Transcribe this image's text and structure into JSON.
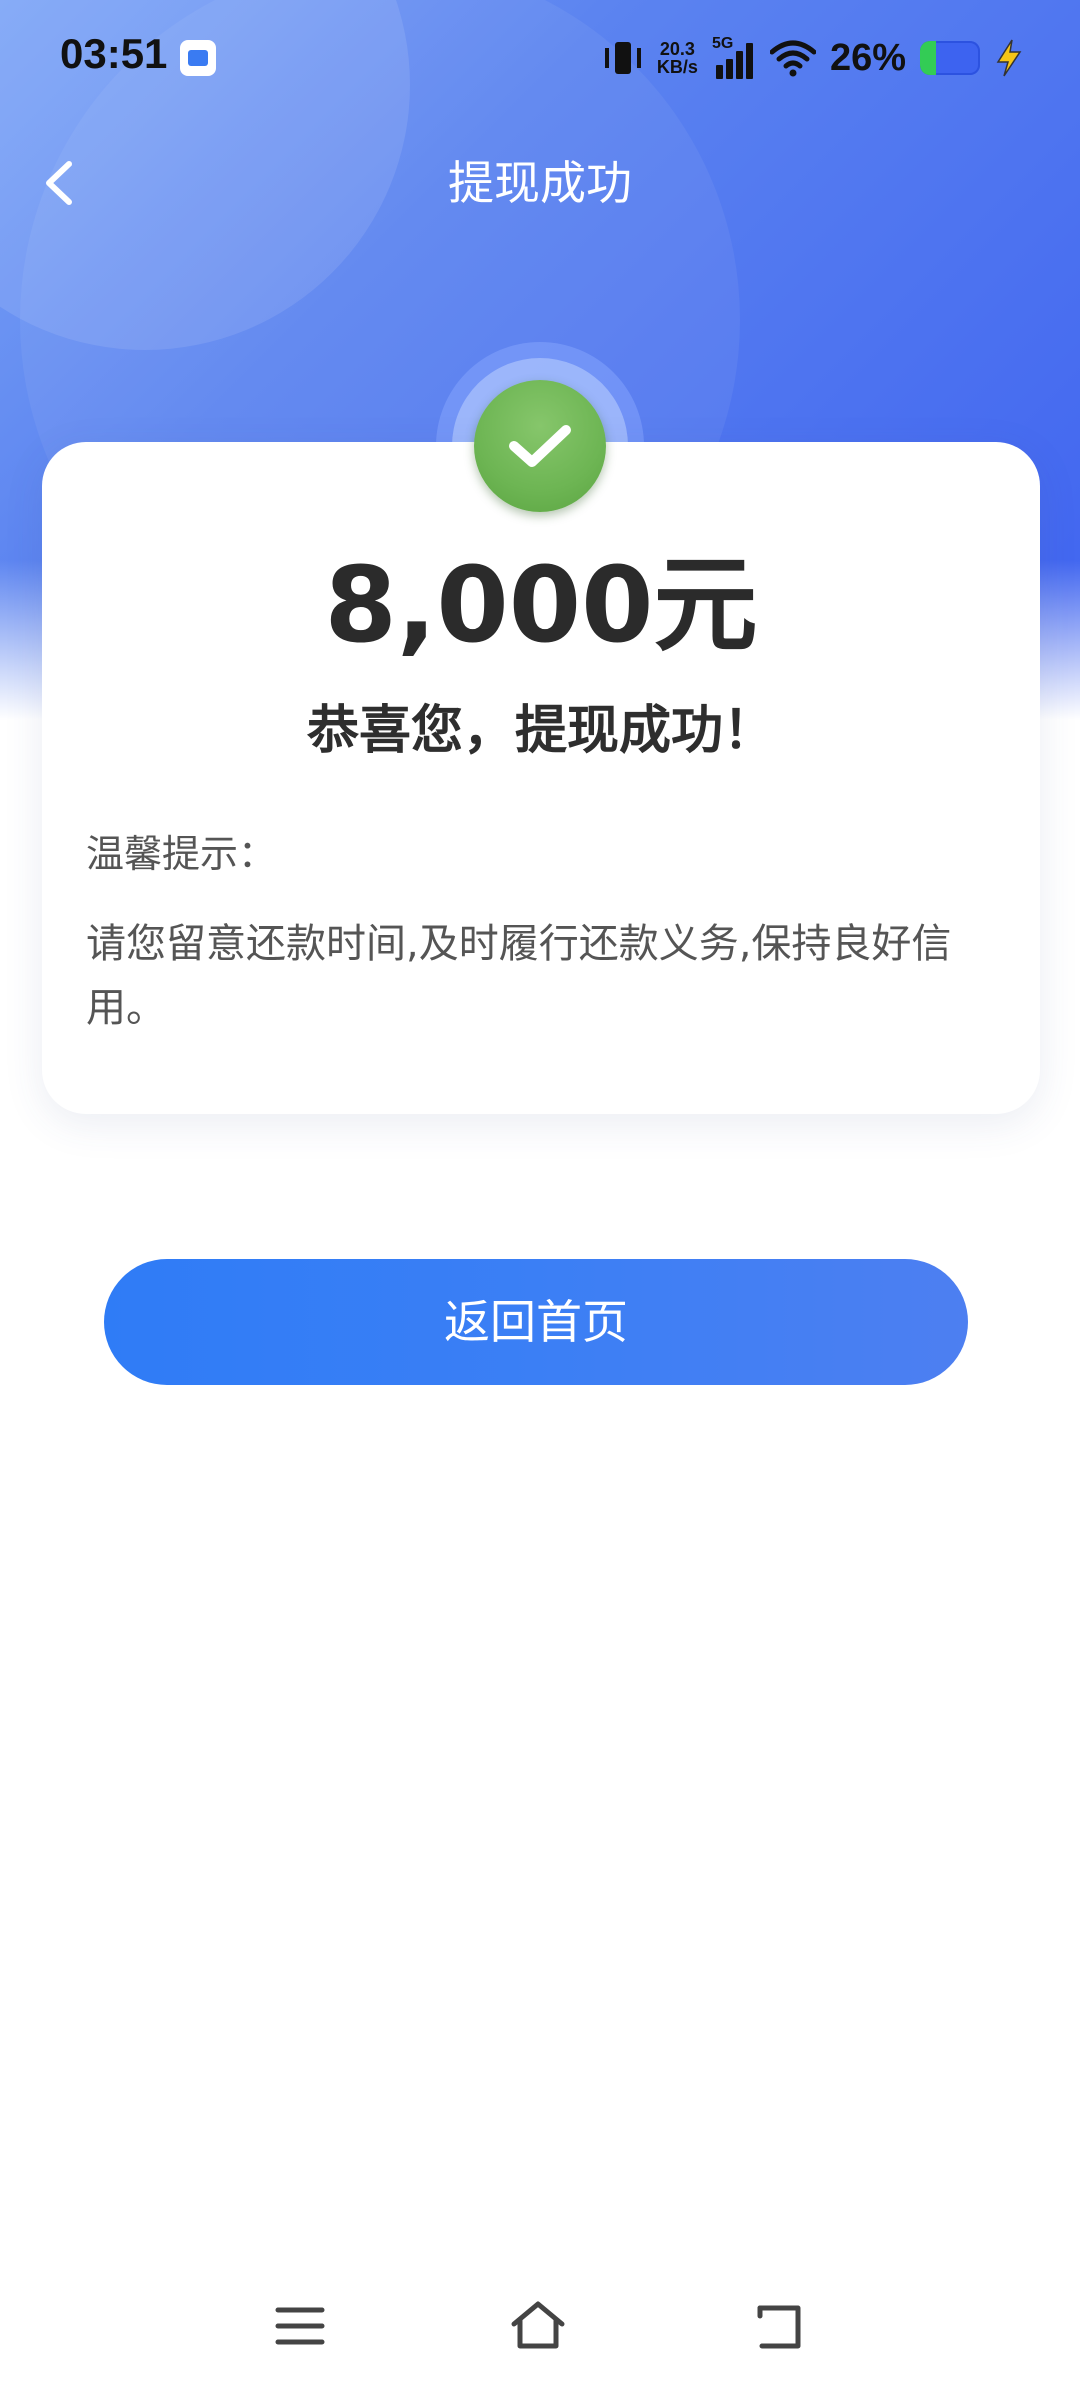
{
  "status_bar": {
    "time": "03:51",
    "net_speed_value": "20.3",
    "net_speed_unit": "KB/s",
    "network_type": "5G",
    "battery_percent": "26%"
  },
  "header": {
    "title": "提现成功"
  },
  "result": {
    "amount": "8,000元",
    "message": "恭喜您，提现成功！"
  },
  "tips": {
    "title": "温馨提示：",
    "body": "请您留意还款时间,及时履行还款义务,保持良好信用。"
  },
  "actions": {
    "home_label": "返回首页"
  },
  "colors": {
    "primary": "#3b7ff5",
    "success": "#6db553",
    "header_blue": "#4a6ff0"
  }
}
